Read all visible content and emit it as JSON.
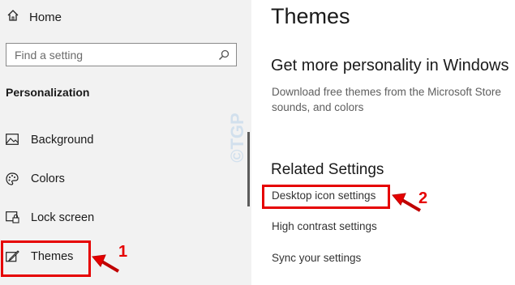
{
  "sidebar": {
    "home_label": "Home",
    "search_placeholder": "Find a setting",
    "section_title": "Personalization",
    "items": [
      {
        "label": "Background",
        "icon": "image-icon"
      },
      {
        "label": "Colors",
        "icon": "palette-icon"
      },
      {
        "label": "Lock screen",
        "icon": "lock-screen-icon"
      },
      {
        "label": "Themes",
        "icon": "themes-brush-icon",
        "selected": true
      }
    ]
  },
  "main": {
    "title": "Themes",
    "personality_heading": "Get more personality in Windows",
    "personality_desc": "Download free themes from the Microsoft Store sounds, and colors",
    "related_heading": "Related Settings",
    "links": [
      "Desktop icon settings",
      "High contrast settings",
      "Sync your settings"
    ]
  },
  "annotations": {
    "step1": "1",
    "step2": "2",
    "color": "#e60000"
  },
  "watermark": "©TGP"
}
